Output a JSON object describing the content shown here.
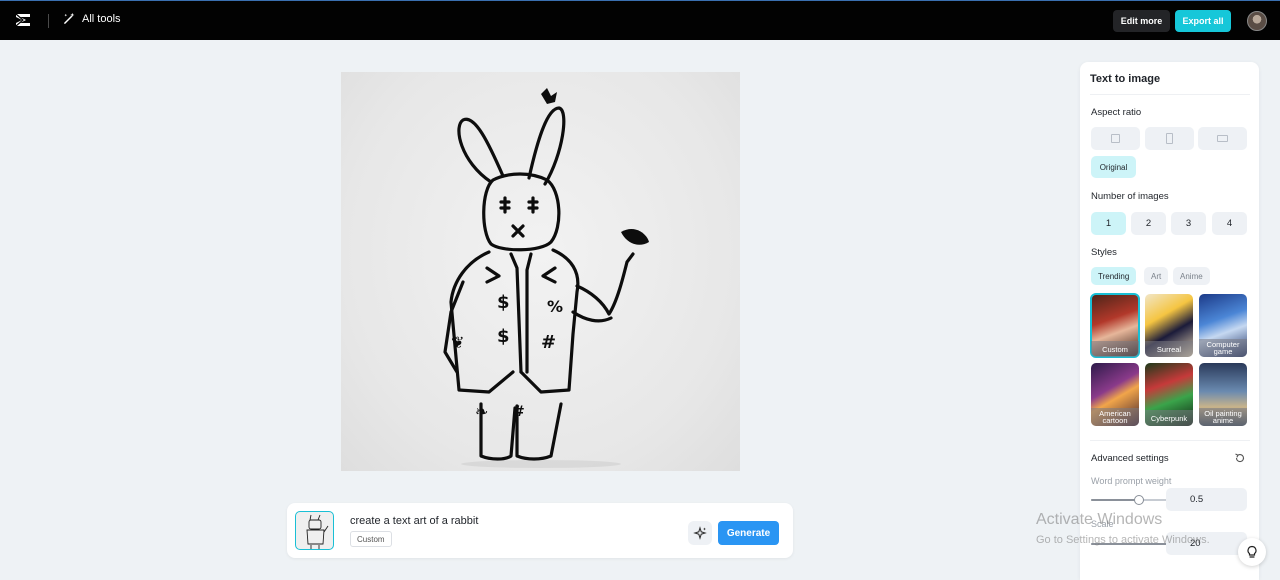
{
  "topbar": {
    "logo_icon": "capcut-logo-icon",
    "all_tools_label": "All tools",
    "edit_more_label": "Edit more",
    "export_all_label": "Export all"
  },
  "prompt": {
    "text": "create a text art of a rabbit",
    "style_chip": "Custom",
    "generate_label": "Generate"
  },
  "panel": {
    "title": "Text to image",
    "aspect_ratio_label": "Aspect ratio",
    "original_label": "Original",
    "number_of_images_label": "Number of images",
    "numbers": [
      "1",
      "2",
      "3",
      "4"
    ],
    "selected_number": "1",
    "styles_label": "Styles",
    "style_tabs": [
      "Trending",
      "Art",
      "Anime"
    ],
    "styles": [
      {
        "label": "Custom",
        "selected": true
      },
      {
        "label": "Surreal"
      },
      {
        "label": "Computer game"
      },
      {
        "label": "American cartoon"
      },
      {
        "label": "Cyberpunk"
      },
      {
        "label": "Oil painting anime"
      }
    ],
    "advanced_settings_label": "Advanced settings",
    "word_prompt_weight_label": "Word prompt weight",
    "word_prompt_weight_value": "0.5",
    "scale_label": "Scale",
    "scale_value": "20",
    "colors": {
      "accent": "#16c7d9",
      "generate": "#2a95f3",
      "selected_bg": "#cdf4f8"
    }
  },
  "watermark": {
    "title": "Activate Windows",
    "subtitle": "Go to Settings to activate Windows."
  }
}
